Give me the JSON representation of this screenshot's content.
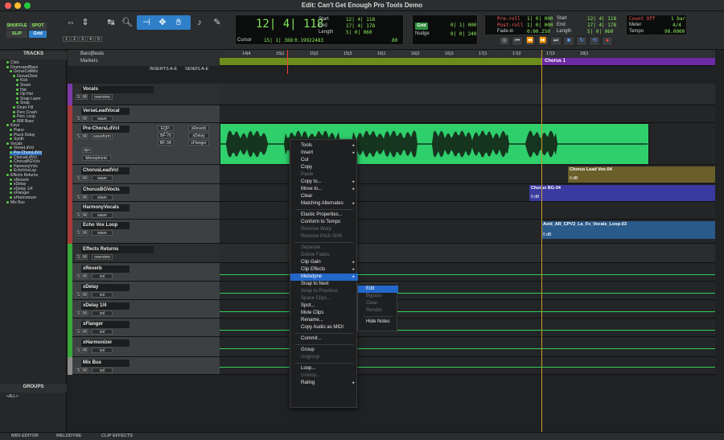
{
  "window": {
    "title": "Edit: Can't Get Enough Pro Tools Demo"
  },
  "toolbar": {
    "modes": {
      "shuffle": "SHUFFLE",
      "spot": "SPOT",
      "slip": "SLIP",
      "grid": "Grid"
    },
    "zoom_presets": [
      "1",
      "2",
      "3",
      "4",
      "5"
    ],
    "main_counter": "12| 4| 118",
    "start_label": "Start",
    "end_label": "End",
    "length_label": "Length",
    "start": "12| 4| 118",
    "end": "17| 4| 178",
    "length": "5| 0| 060",
    "cursor_label": "Cursor",
    "cursor": "15| 1| 388",
    "cursor_sample": "0.19922483",
    "grid_value": "0| 1| 000",
    "nudge_label": "Nudge",
    "nudge_value": "0| 0| 240",
    "grid_num": "80",
    "preroll_label": "Pre-roll",
    "postroll_label": "Post-roll",
    "fadein_label": "Fade-in",
    "preroll": "1| 0| 000",
    "postroll": "1| 0| 000",
    "fadein": "0:00.250",
    "t_start": "12| 4| 118",
    "t_end": "17| 4| 178",
    "t_length": "5| 0| 060",
    "count_off": "Count Off",
    "meter_label": "Meter",
    "tempo_label": "Tempo",
    "count_off_value": "1 bar",
    "meter": "4/4",
    "tempo": "90.0000"
  },
  "tracks_panel": {
    "header": "TRACKS",
    "groups_header": "GROUPS",
    "groups_item": "<ALL>",
    "items": [
      "Click",
      "DrumsandBass",
      "GroveCellMix",
      "GroveCltrst",
      "Kick",
      "Snare",
      "Hat",
      "Op Hat",
      "Snap Layer",
      "Snap",
      "Drum Fill",
      "Perc Crash",
      "Perc Loop",
      "808 Bass",
      "Keys",
      "Piano",
      "Pluck Delay",
      "Synth",
      "Vocals",
      "VerseLdVcl",
      "Pre-ChorsLdVcl",
      "ChorusLdVcl",
      "ChorusBGVcls",
      "HarmonyVcls",
      "EchoVoxLop",
      "Effects Returns",
      "xReverb",
      "xDelay",
      "xDelay 1/4",
      "xFlanger",
      "xHarmonizer",
      "Mix Bus"
    ]
  },
  "ruler": {
    "label1": "Bars|Beats",
    "label2": "Markers",
    "col_inserts": "INSERTS A-E",
    "col_sends": "SENDS A-E",
    "ticks": [
      "14|4",
      "15|1",
      "15|2",
      "15|3",
      "16|1",
      "16|2",
      "16|3",
      "17|1",
      "17|2",
      "17|3",
      "18|1"
    ],
    "marker": "Chorus 1"
  },
  "tracks": [
    {
      "name": "Vocals",
      "sub": "overview"
    },
    {
      "name": "VerseLeadVocal",
      "sub": "wave"
    },
    {
      "name": "Pre-ChorsLdVcl",
      "sub": "waveform",
      "inserts": [
        "EQP-1A",
        "BF-76",
        "BF-3A"
      ],
      "sends": [
        "xReverb",
        "xDelay",
        "xFlanger"
      ],
      "extra": "Monophonic",
      "dyn": "dyn"
    },
    {
      "name": "ChorusLeadVcl",
      "sub": "wave"
    },
    {
      "name": "ChorusBGVocls",
      "sub": "wave"
    },
    {
      "name": "HarmonyVocals",
      "sub": "wave"
    },
    {
      "name": "Echo Vox Loop",
      "sub": "wave"
    },
    {
      "name": "Effects Returns",
      "sub": "overview"
    },
    {
      "name": "xReverb",
      "sub": "vol"
    },
    {
      "name": "xDelay",
      "sub": "vol"
    },
    {
      "name": "xDelay 1/4",
      "sub": "vol"
    },
    {
      "name": "xFlanger",
      "sub": "vol"
    },
    {
      "name": "xHarmonizer",
      "sub": "vol"
    },
    {
      "name": "Mix Bus",
      "sub": "vol"
    }
  ],
  "clips": {
    "chorus_lead": "Chorus Lead Vox-04",
    "chorus_bg": "Chorus BG-04",
    "echo": "Avid_AR_CPV2_La_Fx_Vocals_Loop-03",
    "db": "0 dB"
  },
  "context_menu": {
    "items": [
      "Tools",
      "Insert",
      "Cut",
      "Copy",
      "Paste",
      "Copy to...",
      "Move to...",
      "Clear",
      "Matching Alternates",
      "Elastic Properties...",
      "Conform to Tempo",
      "Remove Warp",
      "Remove Pitch Shift",
      "Separate",
      "Delete Fades",
      "Clip Gain",
      "Clip Effects",
      "Melodyne",
      "Snap to Next",
      "Snap to Previous",
      "Space Clips...",
      "Spot...",
      "Mute Clips",
      "Rename...",
      "Copy Audio as MIDI",
      "Commit...",
      "Group",
      "Ungroup",
      "Loop...",
      "Unloop...",
      "Rating"
    ]
  },
  "submenu": {
    "items": [
      "Edit",
      "Bypass",
      "Clear",
      "Render",
      "Hide Notes"
    ]
  },
  "bottom_tabs": [
    "MIDI EDITOR",
    "MELODYNE",
    "CLIP EFFECTS"
  ]
}
